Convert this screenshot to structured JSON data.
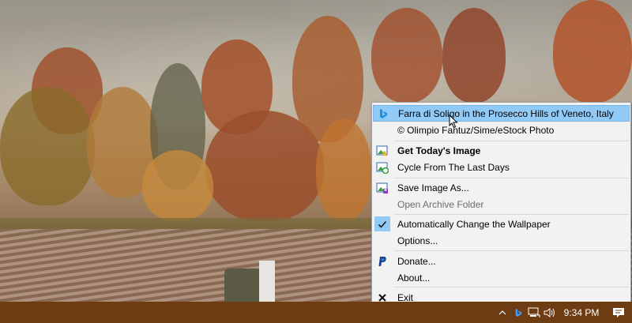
{
  "colors": {
    "taskbar": "#6e3c12",
    "menu_bg": "#f2f2f2",
    "highlight": "#91c9f7"
  },
  "menu": {
    "title_item": {
      "label": "Farra di Soligo in the Prosecco Hills of Veneto, Italy",
      "icon": "bing-icon"
    },
    "copyright_item": {
      "label": "© Olimpio Fantuz/Sime/eStock Photo"
    },
    "get_today": {
      "label": "Get Today's Image",
      "icon": "image-star-icon"
    },
    "cycle": {
      "label": "Cycle From The Last Days",
      "icon": "image-refresh-icon"
    },
    "save_as": {
      "label": "Save Image As...",
      "icon": "save-image-icon"
    },
    "open_archive": {
      "label": "Open Archive Folder"
    },
    "auto_change": {
      "label": "Automatically Change the Wallpaper",
      "icon": "checkmark-icon",
      "checked": true
    },
    "options": {
      "label": "Options..."
    },
    "donate": {
      "label": "Donate...",
      "icon": "paypal-icon"
    },
    "about": {
      "label": "About..."
    },
    "exit": {
      "label": "Exit",
      "icon": "close-icon"
    }
  },
  "taskbar": {
    "tray_icons": [
      "chevron-up-icon",
      "bing-icon",
      "network-icon",
      "volume-icon"
    ],
    "clock": "9:34 PM",
    "notification_icon": "notification-icon"
  }
}
